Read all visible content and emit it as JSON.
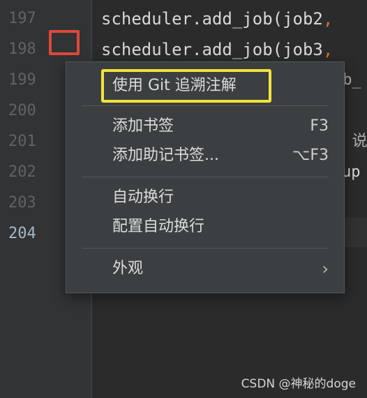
{
  "editor": {
    "line_numbers": [
      "197",
      "198",
      "199",
      "200",
      "201",
      "202",
      "203",
      "204"
    ],
    "code": {
      "line_197": "scheduler.add_job(job2",
      "line_198": "scheduler.add_job(job3",
      "comma": ","
    },
    "partial_fragments": {
      "frag_199": "ob_",
      "frag_201": ", 说",
      "frag_202": "up"
    }
  },
  "context_menu": {
    "items": [
      {
        "label": "使用 Git 追溯注解",
        "shortcut": ""
      },
      {
        "label": "添加书签",
        "shortcut": "F3"
      },
      {
        "label": "添加助记书签...",
        "shortcut": "⌥F3"
      },
      {
        "label": "自动换行",
        "shortcut": ""
      },
      {
        "label": "配置自动换行",
        "shortcut": ""
      },
      {
        "label": "外观",
        "submenu_icon": "chevron-right-icon"
      }
    ],
    "chevron_glyph": "›"
  },
  "annotations": {
    "highlight_colors": {
      "red": "#e0473a",
      "yellow": "#f3e43a"
    }
  },
  "watermark": "CSDN @神秘的doge"
}
